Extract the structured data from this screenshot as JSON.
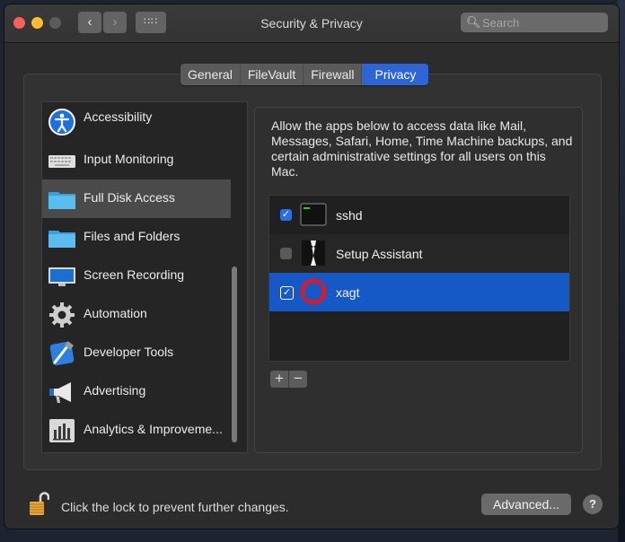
{
  "window": {
    "title": "Security & Privacy",
    "search_placeholder": "Search"
  },
  "tabs": [
    {
      "label": "General"
    },
    {
      "label": "FileVault"
    },
    {
      "label": "Firewall"
    },
    {
      "label": "Privacy",
      "active": true
    }
  ],
  "sidebar": {
    "items": [
      {
        "label": "Accessibility",
        "icon": "accessibility-icon"
      },
      {
        "label": "Input Monitoring",
        "icon": "keyboard-icon"
      },
      {
        "label": "Full Disk Access",
        "icon": "folder-icon",
        "selected": true
      },
      {
        "label": "Files and Folders",
        "icon": "folder-icon"
      },
      {
        "label": "Screen Recording",
        "icon": "display-icon"
      },
      {
        "label": "Automation",
        "icon": "gear-icon"
      },
      {
        "label": "Developer Tools",
        "icon": "xcode-icon"
      },
      {
        "label": "Advertising",
        "icon": "megaphone-icon"
      },
      {
        "label": "Analytics & Improveme...",
        "icon": "bar-chart-icon"
      }
    ]
  },
  "description": "Allow the apps below to access data like Mail, Messages, Safari, Home, Time Machine backups, and certain administrative settings for all users on this Mac.",
  "apps": [
    {
      "name": "sshd",
      "checked": true,
      "icon": "terminal-icon"
    },
    {
      "name": "Setup Assistant",
      "checked": false,
      "icon": "tuxedo-icon"
    },
    {
      "name": "xagt",
      "checked": true,
      "selected": true,
      "icon": "xagt-icon"
    }
  ],
  "list_controls": {
    "add": "+",
    "remove": "−"
  },
  "footer": {
    "lock_text": "Click the lock to prevent further changes.",
    "advanced_label": "Advanced...",
    "help_label": "?"
  },
  "colors": {
    "accent": "#2d64d6",
    "selected_row": "#1758c7",
    "window_bg": "#2c2c2c"
  }
}
